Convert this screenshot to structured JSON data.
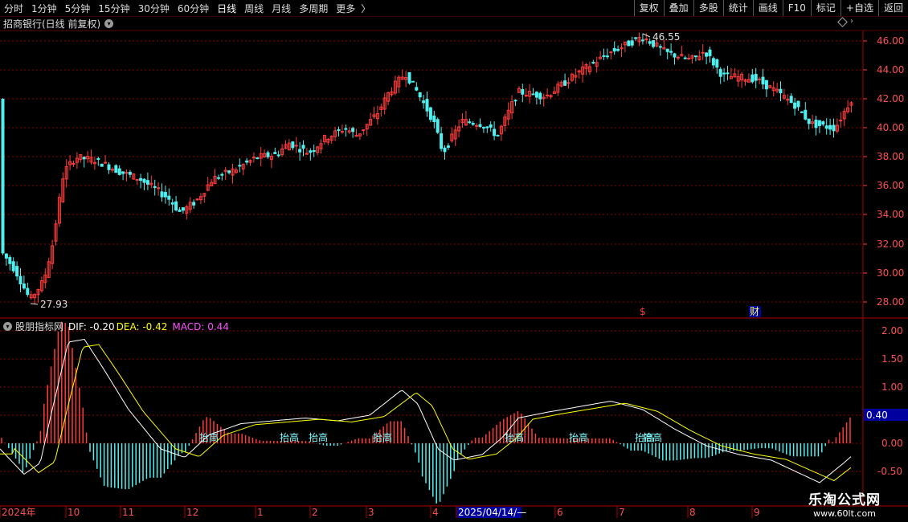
{
  "toolbar": {
    "timeframes": [
      "分时",
      "1分钟",
      "5分钟",
      "15分钟",
      "30分钟",
      "60分钟",
      "日线",
      "周线",
      "月线",
      "多周期",
      "更多"
    ],
    "active": "日线",
    "more_arrow": "〉",
    "right_buttons": [
      "复权",
      "叠加",
      "多股",
      "统计",
      "画线",
      "F10",
      "标记",
      "+自选",
      "返回"
    ]
  },
  "main_title": "招商银行(日线 前复权)",
  "price_axis": [
    "46.00",
    "44.00",
    "42.00",
    "40.00",
    "38.00",
    "36.00",
    "34.00",
    "32.00",
    "30.00",
    "28.00"
  ],
  "price_high_label": "46.55",
  "price_low_label": "27.93",
  "event_markers": [
    "$",
    "财"
  ],
  "macd": {
    "name": "股朋指标网",
    "dif_label": "DIF: -0.20",
    "dea_label": "DEA: -0.42",
    "macd_label": "MACD: 0.44",
    "axis": [
      "2.00",
      "1.50",
      "1.00",
      "0.50",
      "0.00",
      "-0.50"
    ],
    "current_value": "0.40",
    "annotation": "抬高"
  },
  "date_axis": [
    "2024年",
    "10",
    "11",
    "12",
    "1",
    "2",
    "3",
    "4",
    "2025/04/14/—",
    "6",
    "7",
    "8",
    "9"
  ],
  "watermark": {
    "title": "乐淘公式网",
    "url": "www.60lt.com"
  },
  "colors": {
    "up": "#ff3c3c",
    "down": "#50f0f0",
    "dif": "#ffffff",
    "dea": "#ffff00",
    "macd_label": "#ff50ff",
    "grid": "#8b0000"
  }
}
